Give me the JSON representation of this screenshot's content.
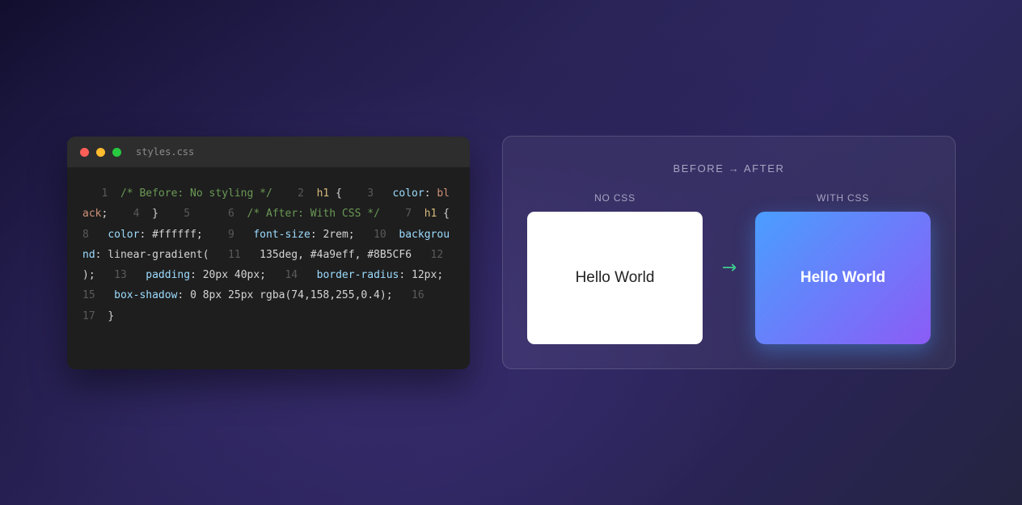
{
  "editor": {
    "filename": "styles.css",
    "window_buttons": [
      "close",
      "minimize",
      "maximize"
    ],
    "tokens": [
      {
        "t": "   1  ",
        "c": "ln"
      },
      {
        "t": "/* Before: No styling */",
        "c": "cm"
      },
      {
        "t": "    2  ",
        "c": "ln"
      },
      {
        "t": "h1",
        "c": "sel"
      },
      {
        "t": " {",
        "c": "pn"
      },
      {
        "t": "    3   ",
        "c": "ln"
      },
      {
        "t": "color",
        "c": "pr"
      },
      {
        "t": ": ",
        "c": "pn"
      },
      {
        "t": "black",
        "c": "kw"
      },
      {
        "t": ";",
        "c": "pn"
      },
      {
        "t": "    4  ",
        "c": "ln"
      },
      {
        "t": "}",
        "c": "pn"
      },
      {
        "t": "    5   ",
        "c": "ln"
      },
      {
        "t": "   6  ",
        "c": "ln"
      },
      {
        "t": "/* After: With CSS */",
        "c": "cm"
      },
      {
        "t": "    7  ",
        "c": "ln"
      },
      {
        "t": "h1",
        "c": "sel"
      },
      {
        "t": " {",
        "c": "pn"
      },
      {
        "t": "    8   ",
        "c": "ln"
      },
      {
        "t": "color",
        "c": "pr"
      },
      {
        "t": ": #ffffff;",
        "c": "pn"
      },
      {
        "t": "    9   ",
        "c": "ln"
      },
      {
        "t": "font-size",
        "c": "pr"
      },
      {
        "t": ": 2rem;",
        "c": "pn"
      },
      {
        "t": "   10  ",
        "c": "ln"
      },
      {
        "t": "background",
        "c": "pr"
      },
      {
        "t": ": linear-gradient(",
        "c": "pn"
      },
      {
        "t": "   11   ",
        "c": "ln"
      },
      {
        "t": "135deg, #4a9eff,",
        "c": "pn"
      },
      {
        "t": " #8B5CF6",
        "c": "pn"
      },
      {
        "t": "   12   ",
        "c": "ln"
      },
      {
        "t": ");",
        "c": "pn"
      },
      {
        "t": "   13   ",
        "c": "ln"
      },
      {
        "t": "padding",
        "c": "pr"
      },
      {
        "t": ": 20px 40px;",
        "c": "pn"
      },
      {
        "t": "   14   ",
        "c": "ln"
      },
      {
        "t": "border-radius",
        "c": "pr"
      },
      {
        "t": ": 12px;",
        "c": "pn"
      },
      {
        "t": "   15   ",
        "c": "ln"
      },
      {
        "t": "box-shadow",
        "c": "pr"
      },
      {
        "t": ": 0 8px 25px rgba(74,158,255,0.4);",
        "c": "pn"
      },
      {
        "t": "   16   ",
        "c": "ln"
      },
      {
        "t": "   17  ",
        "c": "ln"
      },
      {
        "t": "}",
        "c": "pn"
      }
    ]
  },
  "preview": {
    "title": "BEFORE → AFTER",
    "before_label": "NO CSS",
    "after_label": "WITH CSS",
    "before_text": "Hello World",
    "after_text": "Hello World",
    "arrow": "→",
    "colors": {
      "gradient_start": "#4a9eff",
      "gradient_end": "#8b5cf6",
      "arrow": "#3ecf8e"
    }
  }
}
